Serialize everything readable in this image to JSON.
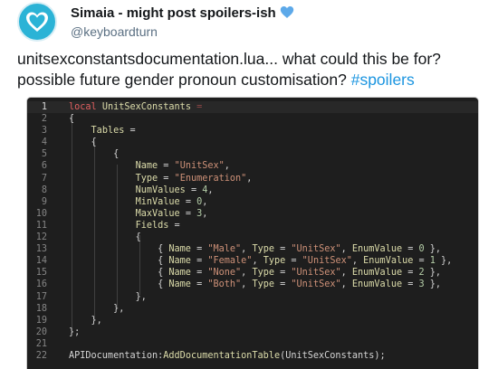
{
  "tweet": {
    "display_name": "Simaia - might post spoilers-ish",
    "handle": "@keyboardturn",
    "text_line1": "unitsexconstantsdocumentation.lua... what could this be for?",
    "text_line2_plain": "possible future gender pronoun customisation? ",
    "hashtag": "#spoilers",
    "colors": {
      "hashtag": "#1b95e0",
      "avatar": "#2bb3d6",
      "heart": "#5da9e9"
    },
    "icons": {
      "avatar": "heart-avatar-icon",
      "badge": "blue-heart-icon"
    }
  },
  "code": {
    "lines": [
      {
        "n": "1",
        "tokens": [
          [
            "kw",
            "local"
          ],
          [
            "op",
            " "
          ],
          [
            "id",
            "UnitSexConstants"
          ],
          [
            "op",
            " "
          ],
          [
            "faded",
            "="
          ]
        ]
      },
      {
        "n": "2",
        "tokens": [
          [
            "op",
            "{"
          ]
        ]
      },
      {
        "n": "3",
        "tokens": [
          [
            "op",
            "    "
          ],
          [
            "id",
            "Tables"
          ],
          [
            "op",
            " ="
          ]
        ]
      },
      {
        "n": "4",
        "tokens": [
          [
            "op",
            "    {"
          ]
        ]
      },
      {
        "n": "5",
        "tokens": [
          [
            "op",
            "        {"
          ]
        ]
      },
      {
        "n": "6",
        "tokens": [
          [
            "op",
            "            "
          ],
          [
            "id",
            "Name"
          ],
          [
            "op",
            " = "
          ],
          [
            "str",
            "\"UnitSex\""
          ],
          [
            "op",
            ","
          ]
        ]
      },
      {
        "n": "7",
        "tokens": [
          [
            "op",
            "            "
          ],
          [
            "id",
            "Type"
          ],
          [
            "op",
            " = "
          ],
          [
            "str",
            "\"Enumeration\""
          ],
          [
            "op",
            ","
          ]
        ]
      },
      {
        "n": "8",
        "tokens": [
          [
            "op",
            "            "
          ],
          [
            "id",
            "NumValues"
          ],
          [
            "op",
            " = "
          ],
          [
            "num",
            "4"
          ],
          [
            "op",
            ","
          ]
        ]
      },
      {
        "n": "9",
        "tokens": [
          [
            "op",
            "            "
          ],
          [
            "id",
            "MinValue"
          ],
          [
            "op",
            " = "
          ],
          [
            "num",
            "0"
          ],
          [
            "op",
            ","
          ]
        ]
      },
      {
        "n": "10",
        "tokens": [
          [
            "op",
            "            "
          ],
          [
            "id",
            "MaxValue"
          ],
          [
            "op",
            " = "
          ],
          [
            "num",
            "3"
          ],
          [
            "op",
            ","
          ]
        ]
      },
      {
        "n": "11",
        "tokens": [
          [
            "op",
            "            "
          ],
          [
            "id",
            "Fields"
          ],
          [
            "op",
            " ="
          ]
        ]
      },
      {
        "n": "12",
        "tokens": [
          [
            "op",
            "            {"
          ]
        ]
      },
      {
        "n": "13",
        "tokens": [
          [
            "op",
            "                { "
          ],
          [
            "id",
            "Name"
          ],
          [
            "op",
            " = "
          ],
          [
            "str",
            "\"Male\""
          ],
          [
            "op",
            ", "
          ],
          [
            "id",
            "Type"
          ],
          [
            "op",
            " = "
          ],
          [
            "str",
            "\"UnitSex\""
          ],
          [
            "op",
            ", "
          ],
          [
            "id",
            "EnumValue"
          ],
          [
            "op",
            " = "
          ],
          [
            "num",
            "0"
          ],
          [
            "op",
            " },"
          ]
        ]
      },
      {
        "n": "14",
        "tokens": [
          [
            "op",
            "                { "
          ],
          [
            "id",
            "Name"
          ],
          [
            "op",
            " = "
          ],
          [
            "str",
            "\"Female\""
          ],
          [
            "op",
            ", "
          ],
          [
            "id",
            "Type"
          ],
          [
            "op",
            " = "
          ],
          [
            "str",
            "\"UnitSex\""
          ],
          [
            "op",
            ", "
          ],
          [
            "id",
            "EnumValue"
          ],
          [
            "op",
            " = "
          ],
          [
            "num",
            "1"
          ],
          [
            "op",
            " },"
          ]
        ]
      },
      {
        "n": "15",
        "tokens": [
          [
            "op",
            "                { "
          ],
          [
            "id",
            "Name"
          ],
          [
            "op",
            " = "
          ],
          [
            "str",
            "\"None\""
          ],
          [
            "op",
            ", "
          ],
          [
            "id",
            "Type"
          ],
          [
            "op",
            " = "
          ],
          [
            "str",
            "\"UnitSex\""
          ],
          [
            "op",
            ", "
          ],
          [
            "id",
            "EnumValue"
          ],
          [
            "op",
            " = "
          ],
          [
            "num",
            "2"
          ],
          [
            "op",
            " },"
          ]
        ]
      },
      {
        "n": "16",
        "tokens": [
          [
            "op",
            "                { "
          ],
          [
            "id",
            "Name"
          ],
          [
            "op",
            " = "
          ],
          [
            "str",
            "\"Both\""
          ],
          [
            "op",
            ", "
          ],
          [
            "id",
            "Type"
          ],
          [
            "op",
            " = "
          ],
          [
            "str",
            "\"UnitSex\""
          ],
          [
            "op",
            ", "
          ],
          [
            "id",
            "EnumValue"
          ],
          [
            "op",
            " = "
          ],
          [
            "num",
            "3"
          ],
          [
            "op",
            " },"
          ]
        ]
      },
      {
        "n": "17",
        "tokens": [
          [
            "op",
            "            },"
          ]
        ]
      },
      {
        "n": "18",
        "tokens": [
          [
            "op",
            "        },"
          ]
        ]
      },
      {
        "n": "19",
        "tokens": [
          [
            "op",
            "    },"
          ]
        ]
      },
      {
        "n": "20",
        "tokens": [
          [
            "op",
            "};"
          ]
        ]
      },
      {
        "n": "21",
        "tokens": []
      },
      {
        "n": "22",
        "tokens": [
          [
            "ident",
            "APIDocumentation"
          ],
          [
            "op",
            ":"
          ],
          [
            "fn",
            "AddDocumentationTable"
          ],
          [
            "op",
            "("
          ],
          [
            "ident",
            "UnitSexConstants"
          ],
          [
            "op",
            ");"
          ]
        ]
      }
    ],
    "active_line": "1"
  }
}
